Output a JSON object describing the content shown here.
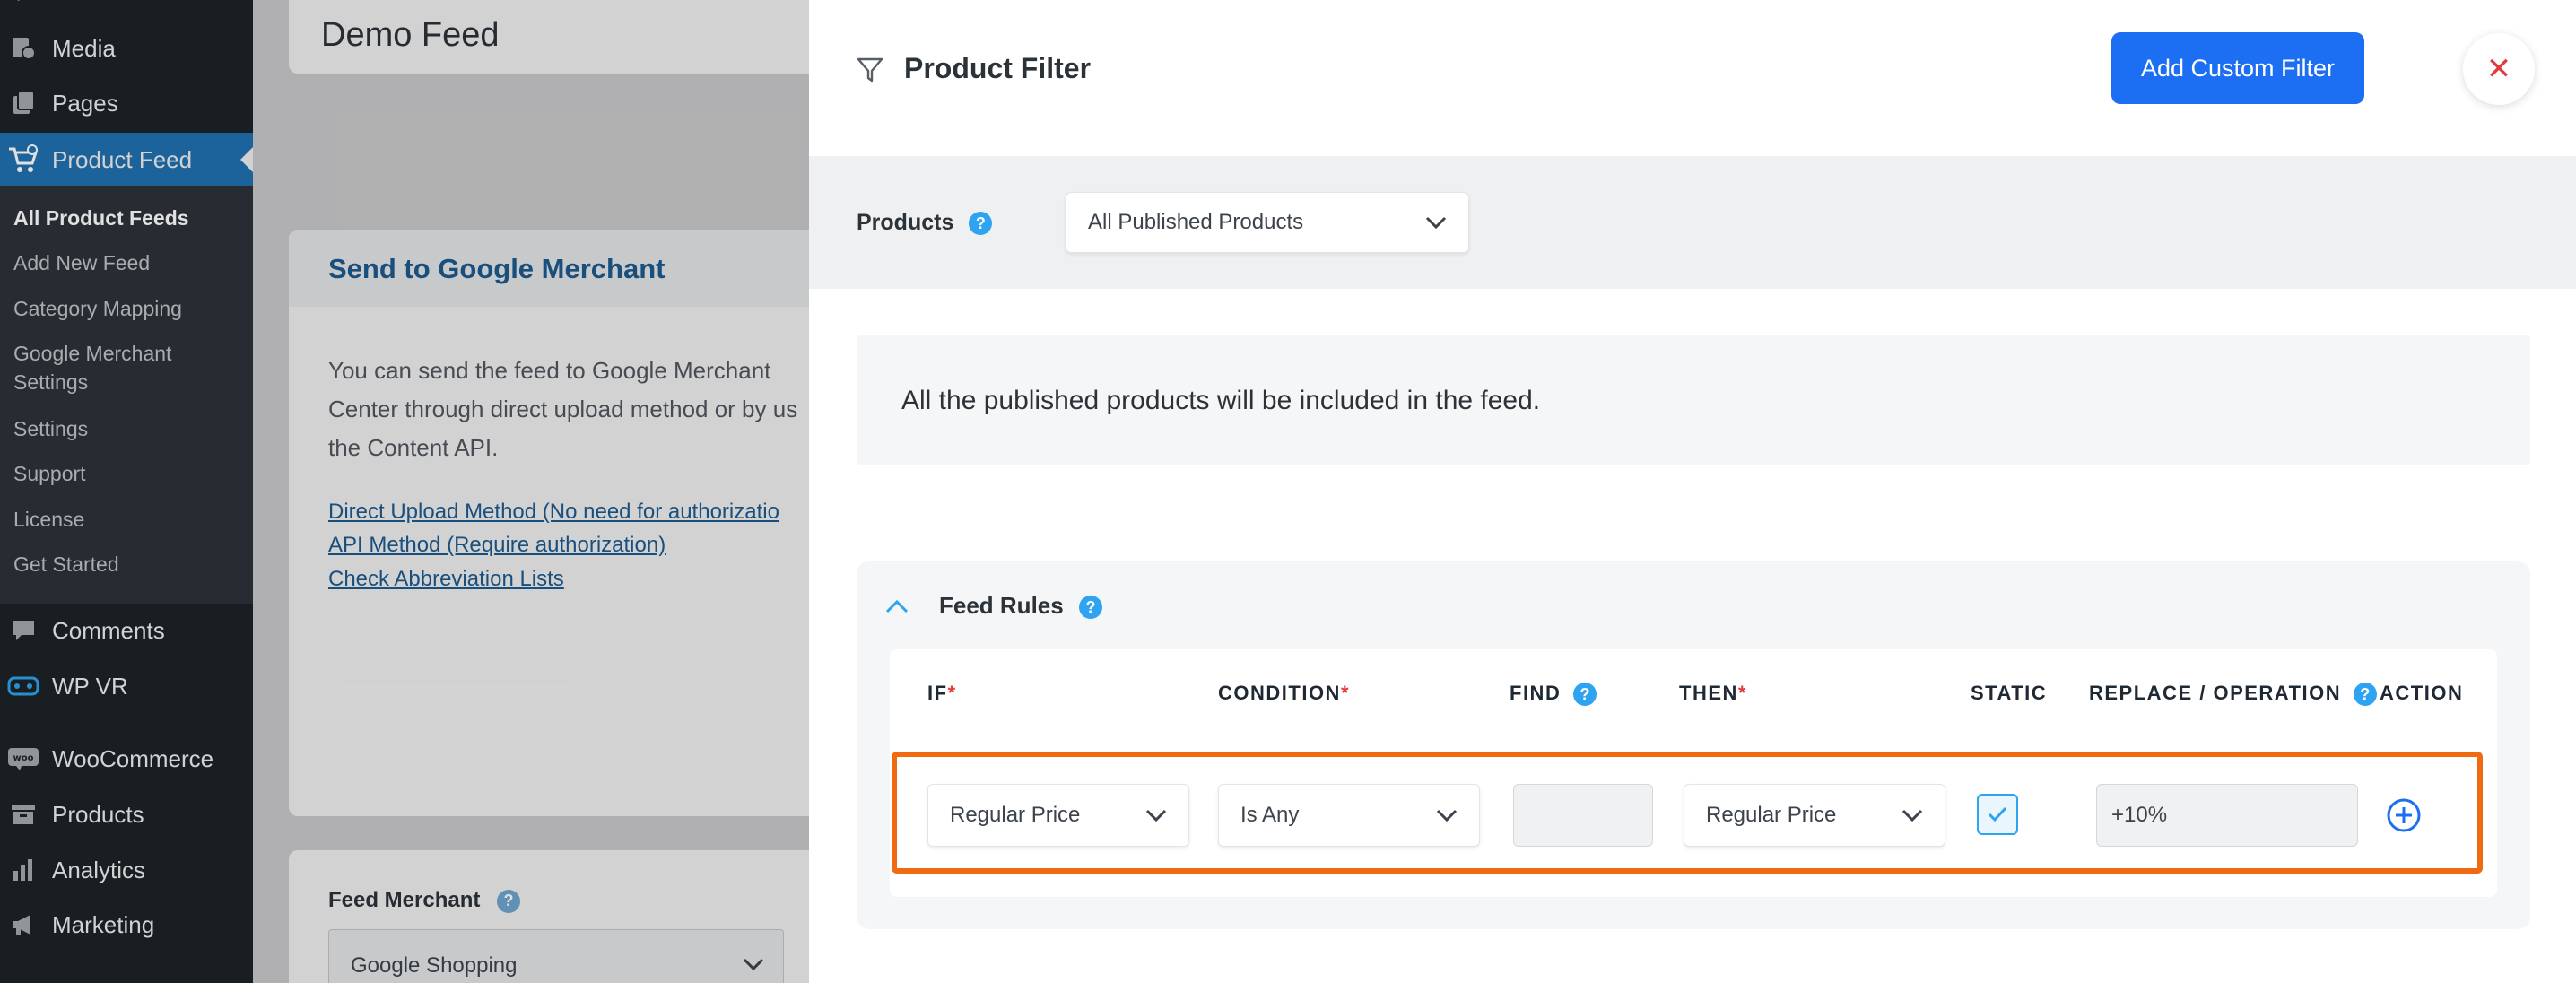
{
  "sidebar": {
    "top_items": [
      {
        "label": "Media",
        "icon": "media-icon"
      },
      {
        "label": "Pages",
        "icon": "pages-icon"
      },
      {
        "label": "Product Feed",
        "icon": "product-feed-icon",
        "active": true
      }
    ],
    "submenu": [
      {
        "label": "All Product Feeds",
        "current": true
      },
      {
        "label": "Add New Feed"
      },
      {
        "label": "Category Mapping"
      },
      {
        "label": "Google Merchant"
      },
      {
        "label": "Settings"
      },
      {
        "label": "Settings"
      },
      {
        "label": "Support"
      },
      {
        "label": "License"
      },
      {
        "label": "Get Started"
      }
    ],
    "bottom_items": [
      {
        "label": "Comments",
        "icon": "comments-icon"
      },
      {
        "label": "WP VR",
        "icon": "wp-vr-icon"
      },
      {
        "label": "WooCommerce",
        "icon": "woocommerce-icon"
      },
      {
        "label": "Products",
        "icon": "products-icon"
      },
      {
        "label": "Analytics",
        "icon": "analytics-icon"
      },
      {
        "label": "Marketing",
        "icon": "marketing-icon"
      }
    ]
  },
  "background": {
    "feed_title": "Demo Feed",
    "google_card": {
      "title": "Send to Google Merchant",
      "description_lines": [
        "You can send the feed to Google Merchant",
        "Center through direct upload method or by us",
        "the Content API."
      ],
      "links": [
        "Direct Upload Method (No need for authorizatio",
        "API Method (Require authorization)",
        "Check Abbreviation Lists"
      ]
    },
    "feed_merchant": {
      "label": "Feed Merchant",
      "help": "?",
      "value": "Google Shopping"
    }
  },
  "drawer": {
    "title": "Product Filter",
    "add_button": "Add Custom Filter",
    "close_symbol": "✕",
    "products": {
      "label": "Products",
      "help": "?",
      "selected": "All Published Products"
    },
    "info_text": "All the published products will be included in the feed.",
    "feed_rules": {
      "title": "Feed Rules",
      "help": "?",
      "columns": {
        "if": "IF",
        "condition": "CONDITION",
        "find": "FIND",
        "then": "THEN",
        "static": "STATIC",
        "replace": "REPLACE / OPERATION",
        "action": "ACTION"
      },
      "required_mark": "*",
      "row": {
        "if_value": "Regular Price",
        "condition_value": "Is Any",
        "find_value": "",
        "then_value": "Regular Price",
        "static_checked": true,
        "replace_value": "+10%"
      }
    }
  },
  "colors": {
    "sidebar_bg": "#1d2327",
    "sidebar_active": "#2271b1",
    "primary_button": "#1c6ef2",
    "highlight_outline": "#f06a12",
    "close_icon": "#e23b3b",
    "help_badge": "#2ea3f2"
  }
}
